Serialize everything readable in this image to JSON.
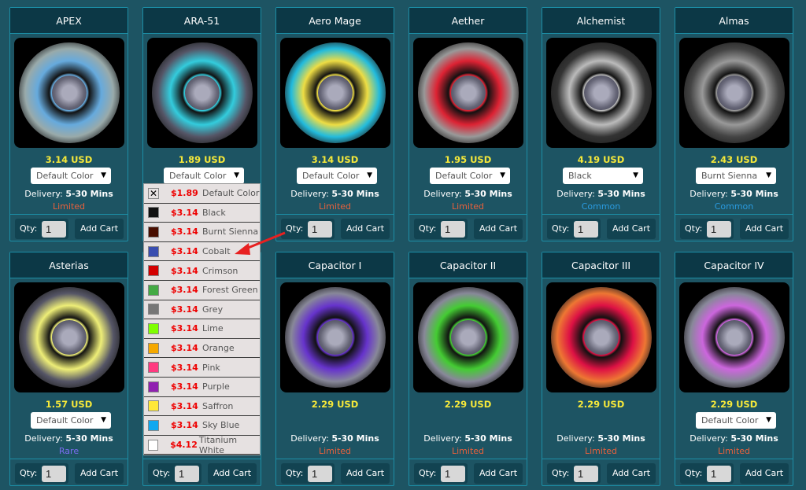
{
  "cards": [
    {
      "title": "APEX",
      "price": "3.14  USD",
      "select": "Default Color",
      "delivery_label": "Delivery:",
      "delivery": "5-30 Mins",
      "rarity": "Limited",
      "qty_label": "Qty:",
      "qty": "1",
      "add": "Add Cart",
      "wheel": [
        "#9aa",
        "#6ad"
      ]
    },
    {
      "title": "ARA-51",
      "price": "1.89  USD",
      "select": "Default Color",
      "delivery_label": "Delivery:",
      "delivery": "5-30 Mins",
      "rarity": "Limited",
      "qty_label": "Qty:",
      "qty": "1",
      "add": "Add Cart",
      "wheel": [
        "#556",
        "#3cd"
      ]
    },
    {
      "title": "Aero Mage",
      "price": "3.14  USD",
      "select": "Default Color",
      "delivery_label": "Delivery:",
      "delivery": "5-30 Mins",
      "rarity": "Limited",
      "qty_label": "Qty:",
      "qty": "1",
      "add": "Add Cart",
      "wheel": [
        "#2bd",
        "#ed4"
      ]
    },
    {
      "title": "Aether",
      "price": "1.95  USD",
      "select": "Default Color",
      "delivery_label": "Delivery:",
      "delivery": "5-30 Mins",
      "rarity": "Limited",
      "qty_label": "Qty:",
      "qty": "1",
      "add": "Add Cart",
      "wheel": [
        "#999",
        "#d23"
      ]
    },
    {
      "title": "Alchemist",
      "price": "4.19  USD",
      "select": "Black",
      "delivery_label": "Delivery:",
      "delivery": "5-30 Mins",
      "rarity": "Common",
      "qty_label": "Qty:",
      "qty": "1",
      "add": "Add Cart",
      "wheel": [
        "#333",
        "#bbb"
      ]
    },
    {
      "title": "Almas",
      "price": "2.43  USD",
      "select": "Burnt Sienna",
      "delivery_label": "Delivery:",
      "delivery": "5-30 Mins",
      "rarity": "Common",
      "qty_label": "Qty:",
      "qty": "1",
      "add": "Add Cart",
      "wheel": [
        "#444",
        "#999"
      ]
    },
    {
      "title": "Asterias",
      "price": "1.57  USD",
      "select": "Default Color",
      "delivery_label": "Delivery:",
      "delivery": "5-30 Mins",
      "rarity": "Rare",
      "qty_label": "Qty:",
      "qty": "1",
      "add": "Add Cart",
      "wheel": [
        "#556",
        "#ee7"
      ]
    },
    {
      "title": "",
      "price": "",
      "select": "",
      "delivery_label": "",
      "delivery": "",
      "rarity": "",
      "qty_label": "Qty:",
      "qty": "1",
      "add": "Add Cart",
      "wheel": null
    },
    {
      "title": "Capacitor I",
      "price": "2.29  USD",
      "select": "",
      "delivery_label": "Delivery:",
      "delivery": "5-30 Mins",
      "rarity": "Limited",
      "qty_label": "Qty:",
      "qty": "1",
      "add": "Add Cart",
      "wheel": [
        "#889",
        "#63c"
      ]
    },
    {
      "title": "Capacitor II",
      "price": "2.29  USD",
      "select": "",
      "delivery_label": "Delivery:",
      "delivery": "5-30 Mins",
      "rarity": "Limited",
      "qty_label": "Qty:",
      "qty": "1",
      "add": "Add Cart",
      "wheel": [
        "#889",
        "#4c3"
      ]
    },
    {
      "title": "Capacitor III",
      "price": "2.29  USD",
      "select": "",
      "delivery_label": "Delivery:",
      "delivery": "5-30 Mins",
      "rarity": "Limited",
      "qty_label": "Qty:",
      "qty": "1",
      "add": "Add Cart",
      "wheel": [
        "#e73",
        "#d14"
      ]
    },
    {
      "title": "Capacitor IV",
      "price": "2.29  USD",
      "select": "Default Color",
      "delivery_label": "Delivery:",
      "delivery": "5-30 Mins",
      "rarity": "Limited",
      "qty_label": "Qty:",
      "qty": "1",
      "add": "Add Cart",
      "wheel": [
        "#889",
        "#c6d"
      ]
    }
  ],
  "rarity_colors": {
    "Limited": "#e8603c",
    "Common": "#2a9be0",
    "Rare": "#7b6cf0"
  },
  "dropdown": [
    {
      "price": "$1.89",
      "name": "Default Color",
      "color": "x"
    },
    {
      "price": "$3.14",
      "name": "Black",
      "color": "#111111"
    },
    {
      "price": "$3.14",
      "name": "Burnt Sienna",
      "color": "#4a0e00"
    },
    {
      "price": "$3.14",
      "name": "Cobalt",
      "color": "#3a4eb0"
    },
    {
      "price": "$3.14",
      "name": "Crimson",
      "color": "#d40000"
    },
    {
      "price": "$3.14",
      "name": "Forest Green",
      "color": "#44aa44"
    },
    {
      "price": "$3.14",
      "name": "Grey",
      "color": "#777777"
    },
    {
      "price": "$3.14",
      "name": "Lime",
      "color": "#7fff00"
    },
    {
      "price": "$3.14",
      "name": "Orange",
      "color": "#f5a800"
    },
    {
      "price": "$3.14",
      "name": "Pink",
      "color": "#ff3a80"
    },
    {
      "price": "$3.14",
      "name": "Purple",
      "color": "#9020b0"
    },
    {
      "price": "$3.14",
      "name": "Saffron",
      "color": "#ffe838"
    },
    {
      "price": "$3.14",
      "name": "Sky Blue",
      "color": "#10a8f0"
    },
    {
      "price": "$4.12",
      "name": "Titanium White",
      "color": "#ffffff"
    }
  ]
}
